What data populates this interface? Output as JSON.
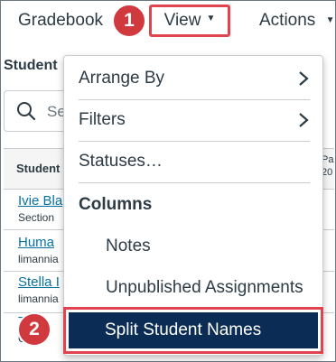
{
  "toolbar": {
    "gradebook_label": "Gradebook",
    "view_label": "View",
    "actions_label": "Actions"
  },
  "callouts": {
    "one": "1",
    "two": "2"
  },
  "background": {
    "students_title": "Student",
    "search_placeholder": "Se",
    "column_header": "Student",
    "assignment_header_1": "Pa",
    "assignment_header_2": "20",
    "rows": [
      {
        "name": "Ivie Bla",
        "sub": "Section"
      },
      {
        "name": "Huma",
        "sub": "limannia"
      },
      {
        "name": "Stella I",
        "sub": "limannia"
      },
      {
        "name": "T",
        "sub": "C"
      }
    ]
  },
  "menu": {
    "arrange_by": "Arrange By",
    "filters": "Filters",
    "statuses": "Statuses…",
    "columns_group": "Columns",
    "notes": "Notes",
    "unpublished": "Unpublished Assignments",
    "split_names": "Split Student Names"
  },
  "colors": {
    "highlight_border": "#e0454f",
    "callout_bg": "#d03a3f",
    "selected_bg": "#0b2d55",
    "link": "#0770a3"
  },
  "icons": {
    "search": "search-icon",
    "caret": "caret-down-icon",
    "chevron": "chevron-right-icon"
  }
}
